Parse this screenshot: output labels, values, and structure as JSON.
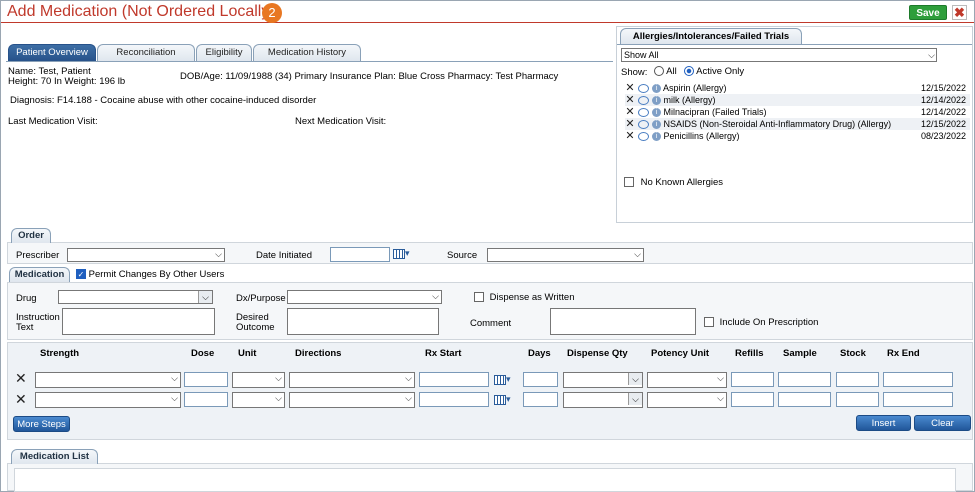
{
  "window": {
    "title": "Add Medication (Not Ordered Locally)",
    "step_badge": "2",
    "save_label": "Save",
    "close_label": "✖"
  },
  "tabs": [
    {
      "label": "Patient Overview",
      "active": true
    },
    {
      "label": "Reconciliation",
      "active": false
    },
    {
      "label": "Eligibility",
      "active": false
    },
    {
      "label": "Medication History",
      "active": false
    }
  ],
  "patient": {
    "name_label": "Name:",
    "name": "Test, Patient",
    "height_label": "Height:",
    "height": "70 In",
    "weight_label": "Weight:",
    "weight": "196 lb",
    "dob_label": "DOB/Age:",
    "dob": "11/09/1988 (34)",
    "insurance_label": "Primary Insurance Plan:",
    "insurance": "Blue Cross",
    "pharmacy_label": "Pharmacy:",
    "pharmacy": "Test Pharmacy",
    "diagnosis_label": "Diagnosis:",
    "diagnosis": "F14.188 - Cocaine abuse with other cocaine-induced disorder",
    "last_visit_label": "Last Medication Visit:",
    "next_visit_label": "Next Medication Visit:"
  },
  "allergies": {
    "tab_label": "Allergies/Intolerances/Failed Trials",
    "filter_value": "Show All",
    "show_label": "Show:",
    "radio_all": "All",
    "radio_active": "Active Only",
    "items": [
      {
        "name": "Aspirin (Allergy)",
        "date": "12/15/2022"
      },
      {
        "name": "milk (Allergy)",
        "date": "12/14/2022"
      },
      {
        "name": "Milnacipran (Failed Trials)",
        "date": "12/14/2022"
      },
      {
        "name": "NSAIDS (Non-Steroidal Anti-Inflammatory Drug) (Allergy)",
        "date": "12/15/2022"
      },
      {
        "name": "Penicillins (Allergy)",
        "date": "08/23/2022"
      }
    ],
    "no_known_label": "No Known Allergies"
  },
  "order": {
    "tab_label": "Order",
    "prescriber_label": "Prescriber",
    "date_initiated_label": "Date Initiated",
    "source_label": "Source"
  },
  "medication": {
    "tab_label": "Medication",
    "permit_label": "Permit Changes By Other Users",
    "drug_label": "Drug",
    "dx_label": "Dx/Purpose",
    "daw_label": "Dispense as Written",
    "instruction_label_1": "Instruction",
    "instruction_label_2": "Text",
    "desired_label_1": "Desired",
    "desired_label_2": "Outcome",
    "comment_label": "Comment",
    "include_label": "Include On Prescription"
  },
  "grid": {
    "headers": [
      "Strength",
      "Dose",
      "Unit",
      "Directions",
      "Rx Start",
      "Days",
      "Dispense Qty",
      "Potency Unit",
      "Refills",
      "Sample",
      "Stock",
      "Rx End"
    ],
    "more_steps_label": "More Steps",
    "insert_label": "Insert",
    "clear_label": "Clear"
  },
  "medication_list": {
    "tab_label": "Medication List"
  }
}
